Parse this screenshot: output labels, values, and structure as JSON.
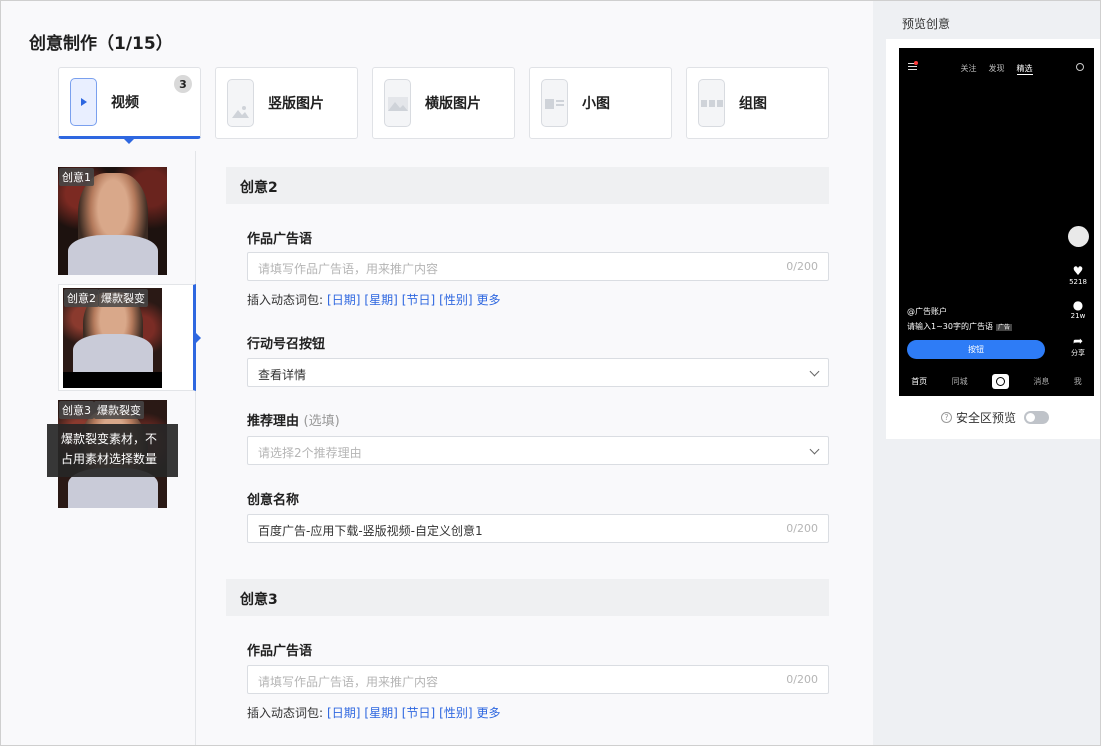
{
  "title": "创意制作（1/15）",
  "types": [
    {
      "label": "视频",
      "badge": "3",
      "icon": "video-phone-icon"
    },
    {
      "label": "竖版图片",
      "icon": "portrait-image-icon"
    },
    {
      "label": "横版图片",
      "icon": "landscape-image-icon"
    },
    {
      "label": "小图",
      "icon": "small-image-icon"
    },
    {
      "label": "组图",
      "icon": "group-image-icon"
    }
  ],
  "thumbnails": [
    {
      "tags": [
        "创意1"
      ]
    },
    {
      "tags": [
        "创意2",
        "爆款裂变"
      ]
    },
    {
      "tags": [
        "创意3",
        "爆款裂变"
      ]
    }
  ],
  "tooltip": "爆款裂变素材，不占用素材选择数量",
  "sections": [
    {
      "heading": "创意2",
      "ad_label": "作品广告语",
      "ad_placeholder": "请填写作品广告语，用来推广内容",
      "ad_count": "0/200",
      "dynamic_label": "插入动态词包:",
      "dynamic_words": [
        "[日期]",
        "[星期]",
        "[节日]",
        "[性别]",
        "更多"
      ],
      "cta_label": "行动号召按钮",
      "cta_value": "查看详情",
      "reason_label": "推荐理由",
      "reason_optional": "(选填)",
      "reason_placeholder": "请选择2个推荐理由",
      "name_label": "创意名称",
      "name_value": "百度广告-应用下载-竖版视频-自定义创意1",
      "name_count": "0/200"
    },
    {
      "heading": "创意3",
      "ad_label": "作品广告语",
      "ad_placeholder": "请填写作品广告语，用来推广内容",
      "ad_count": "0/200",
      "dynamic_label": "插入动态词包:",
      "dynamic_words": [
        "[日期]",
        "[星期]",
        "[节日]",
        "[性别]",
        "更多"
      ]
    }
  ],
  "preview": {
    "title": "预览创意",
    "nav": [
      "关注",
      "发现",
      "精选"
    ],
    "likes": "5218",
    "comments": "21w",
    "share": "分享",
    "account": "@广告账户",
    "ad_text": "请输入1~30字的广告语",
    "ad_tag": "广告",
    "button": "按钮",
    "bottom_nav": [
      "首页",
      "同城",
      "消息",
      "我"
    ],
    "safe_area": "安全区预览"
  },
  "colors": {
    "accent": "#2e67e0"
  }
}
